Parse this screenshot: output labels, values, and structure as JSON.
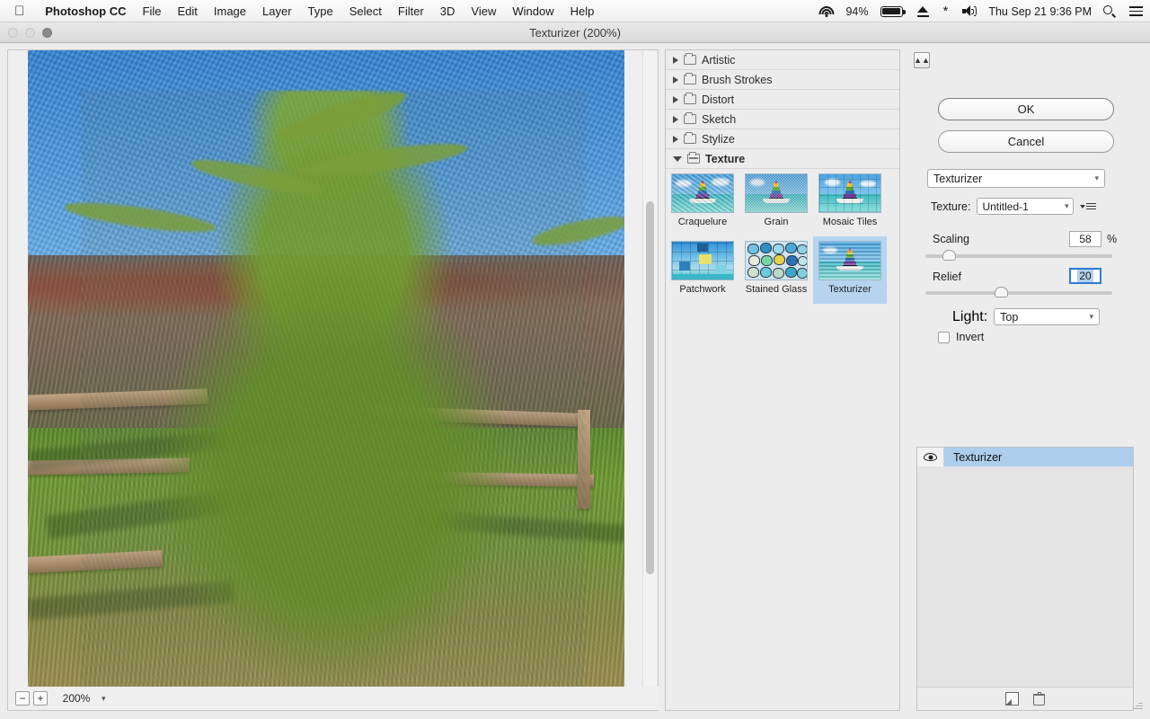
{
  "menubar": {
    "apple_icon": "apple-icon",
    "app_name": "Photoshop CC",
    "items": [
      "File",
      "Edit",
      "Image",
      "Layer",
      "Type",
      "Select",
      "Filter",
      "3D",
      "View",
      "Window",
      "Help"
    ],
    "tray": {
      "wifi_icon": "wifi-icon",
      "battery_percent": "94%",
      "battery_icon": "battery-icon",
      "eject_icon": "eject-icon",
      "bluetooth_icon": "bluetooth-icon",
      "volume_icon": "volume-icon",
      "datetime": "Thu Sep 21  9:36 PM",
      "search_icon": "search-icon",
      "notification_icon": "notification-list-icon"
    }
  },
  "window": {
    "title": "Texturizer (200%)",
    "traffic_lights": [
      "close",
      "minimize",
      "zoom"
    ]
  },
  "preview": {
    "zoom_out_label": "−",
    "zoom_in_label": "+",
    "zoom_value": "200%",
    "zoom_chevron": "chevron-down-icon",
    "scrollbar": "vertical-scrollbar"
  },
  "browser": {
    "categories": [
      {
        "label": "Artistic",
        "expanded": false
      },
      {
        "label": "Brush Strokes",
        "expanded": false
      },
      {
        "label": "Distort",
        "expanded": false
      },
      {
        "label": "Sketch",
        "expanded": false
      },
      {
        "label": "Stylize",
        "expanded": false
      },
      {
        "label": "Texture",
        "expanded": true
      }
    ],
    "filters": [
      {
        "label": "Craquelure",
        "selected": false
      },
      {
        "label": "Grain",
        "selected": false
      },
      {
        "label": "Mosaic Tiles",
        "selected": false
      },
      {
        "label": "Patchwork",
        "selected": false
      },
      {
        "label": "Stained Glass",
        "selected": false
      },
      {
        "label": "Texturizer",
        "selected": true
      }
    ]
  },
  "controls": {
    "collapse_icon": "collapse-panel-icon",
    "ok_label": "OK",
    "cancel_label": "Cancel",
    "preset": "Texturizer",
    "texture_label": "Texture:",
    "texture_value": "Untitled-1",
    "texture_menu_icon": "options-menu-icon",
    "scaling_label": "Scaling",
    "scaling_value": "58",
    "scaling_unit": "%",
    "scaling_percent_pos": 10,
    "relief_label": "Relief",
    "relief_value": "20",
    "relief_percent_pos": 40,
    "light_label": "Light:",
    "light_value": "Top",
    "invert_label": "Invert",
    "invert_checked": false
  },
  "layers": {
    "items": [
      {
        "name": "Texturizer",
        "visible": true,
        "selected": true
      }
    ],
    "new_layer_icon": "new-effect-layer-icon",
    "delete_icon": "trash-icon"
  },
  "colors": {
    "selection_blue": "#b6d3f0",
    "layer_selection_blue": "#adcdec",
    "focus_blue": "#2e7cd6",
    "panel_bg": "#ececec"
  }
}
